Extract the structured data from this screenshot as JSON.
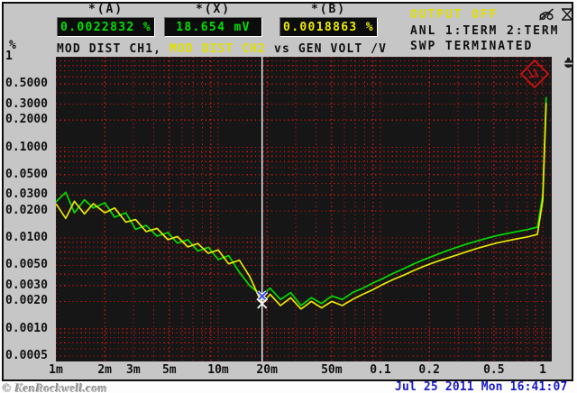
{
  "header": {
    "readouts": [
      {
        "label": "*(A)",
        "value": "0.0022832 %",
        "color": "#00e000"
      },
      {
        "label": "*(X)",
        "value": "18.654 mV",
        "color": "#00e000"
      },
      {
        "label": "*(B)",
        "value": "0.0018863 %",
        "color": "#eded00"
      }
    ],
    "title": {
      "ch1": "MOD DIST CH1, ",
      "ch2": "MOD DIST CH2",
      "vs": " vs ",
      "x_quantity": "GEN VOLT /V"
    },
    "status": {
      "output": "OUTPUT OFF",
      "analyzer": "ANL 1:TERM 2:TERM",
      "sweep": "SWP TERMINATED"
    },
    "y_unit": "%",
    "icons": [
      "audio-monitor-off-icon",
      "display-off-icon",
      "status-glyph-icon"
    ]
  },
  "footer": {
    "watermark": "© KenRockwell.com",
    "timestamp": "Jul 25 2011 Mon 16:41:07"
  },
  "colors": {
    "panel_gray": "#c6c6c6",
    "plot_background": "#161616",
    "grid_red": "#c81616",
    "trace_ch1_green": "#00dd00",
    "trace_ch2_yellow": "#e8e800",
    "cursor_white": "#f5f5f5",
    "marker_blue": "#2f46e8",
    "timestamp_blue": "#1a1acc",
    "logo_red": "#cc1111"
  },
  "chart_data": {
    "type": "line",
    "title": "MOD DIST CH1, MOD DIST CH2 vs GEN VOLT /V",
    "x_scale": "log",
    "y_scale": "log",
    "xlabel": "GEN VOLT /V",
    "ylabel": "%",
    "xlim": [
      0.001,
      1.12
    ],
    "ylim": [
      0.0005,
      1
    ],
    "grid": "red-dotted",
    "x_ticks": [
      {
        "label": "1m",
        "value": 0.001
      },
      {
        "label": "2m",
        "value": 0.002
      },
      {
        "label": "3m",
        "value": 0.003
      },
      {
        "label": "5m",
        "value": 0.005
      },
      {
        "label": "10m",
        "value": 0.01
      },
      {
        "label": "20m",
        "value": 0.02
      },
      {
        "label": "50m",
        "value": 0.05
      },
      {
        "label": "0.1",
        "value": 0.1
      },
      {
        "label": "0.2",
        "value": 0.2
      },
      {
        "label": "0.5",
        "value": 0.5
      },
      {
        "label": "1",
        "value": 1
      }
    ],
    "y_ticks": [
      {
        "label": "1",
        "value": 1
      },
      {
        "label": "0.5000",
        "value": 0.5
      },
      {
        "label": "0.3000",
        "value": 0.3
      },
      {
        "label": "0.2000",
        "value": 0.2
      },
      {
        "label": "0.1000",
        "value": 0.1
      },
      {
        "label": "0.0500",
        "value": 0.05
      },
      {
        "label": "0.0300",
        "value": 0.03
      },
      {
        "label": "0.0200",
        "value": 0.02
      },
      {
        "label": "0.0100",
        "value": 0.01
      },
      {
        "label": "0.0050",
        "value": 0.005
      },
      {
        "label": "0.0030",
        "value": 0.003
      },
      {
        "label": "0.0020",
        "value": 0.002
      },
      {
        "label": "0.0010",
        "value": 0.001
      },
      {
        "label": "0.0005",
        "value": 0.0005
      }
    ],
    "x": [
      0.001,
      0.00115,
      0.0013,
      0.0015,
      0.0017,
      0.002,
      0.0023,
      0.0027,
      0.0031,
      0.0036,
      0.0042,
      0.0049,
      0.0056,
      0.0065,
      0.0075,
      0.0087,
      0.01,
      0.0116,
      0.0135,
      0.0156,
      0.018654,
      0.0209,
      0.0242,
      0.028,
      0.0324,
      0.0375,
      0.0434,
      0.0502,
      0.0581,
      0.0672,
      0.0778,
      0.09,
      0.104,
      0.12,
      0.139,
      0.161,
      0.186,
      0.215,
      0.249,
      0.288,
      0.334,
      0.386,
      0.447,
      0.517,
      0.598,
      0.692,
      0.801,
      0.927,
      1.0,
      1.05
    ],
    "series": [
      {
        "name": "MOD DIST CH1",
        "color": "#00dd00",
        "values": [
          0.025,
          0.032,
          0.019,
          0.0265,
          0.0215,
          0.0245,
          0.017,
          0.019,
          0.0125,
          0.0138,
          0.0105,
          0.0115,
          0.0088,
          0.0096,
          0.0072,
          0.0079,
          0.0058,
          0.0064,
          0.0042,
          0.003,
          0.0022832,
          0.0028,
          0.0021,
          0.0025,
          0.0018,
          0.0022,
          0.0019,
          0.0023,
          0.0021,
          0.0025,
          0.0028,
          0.0032,
          0.0036,
          0.0041,
          0.0046,
          0.0052,
          0.0058,
          0.0064,
          0.0071,
          0.0078,
          0.0085,
          0.0092,
          0.0099,
          0.0106,
          0.0112,
          0.0118,
          0.0124,
          0.0132,
          0.03,
          0.36
        ]
      },
      {
        "name": "MOD DIST CH2",
        "color": "#e8e800",
        "values": [
          0.024,
          0.0165,
          0.0255,
          0.0185,
          0.024,
          0.019,
          0.0215,
          0.015,
          0.016,
          0.0118,
          0.0128,
          0.0096,
          0.0104,
          0.008,
          0.0087,
          0.0068,
          0.0074,
          0.0052,
          0.0057,
          0.0038,
          0.0018863,
          0.0024,
          0.0018,
          0.0022,
          0.00165,
          0.002,
          0.0017,
          0.002,
          0.0018,
          0.0021,
          0.0024,
          0.0027,
          0.0031,
          0.0035,
          0.0039,
          0.0044,
          0.0049,
          0.0054,
          0.0059,
          0.0064,
          0.007,
          0.0076,
          0.0082,
          0.0088,
          0.0093,
          0.0098,
          0.0103,
          0.011,
          0.026,
          0.31
        ]
      }
    ],
    "cursor": {
      "x_volts": 0.018654,
      "ch1_percent": 0.0022832,
      "ch2_percent": 0.0018863
    }
  }
}
